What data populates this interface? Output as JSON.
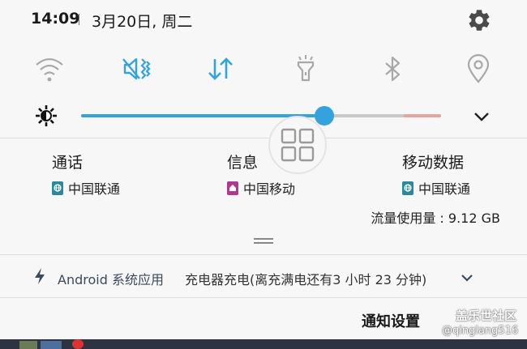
{
  "status": {
    "time": "14:09",
    "date": "3月20日, 周二"
  },
  "toggles": [
    {
      "icon": "wifi-icon",
      "active": false
    },
    {
      "icon": "vibrate-mute-icon",
      "active": true
    },
    {
      "icon": "mobile-data-icon",
      "active": true
    },
    {
      "icon": "flashlight-icon",
      "active": false
    },
    {
      "icon": "bluetooth-icon",
      "active": false
    },
    {
      "icon": "location-icon",
      "active": false
    }
  ],
  "brightness": {
    "level": 0.675,
    "auto": true
  },
  "sim": {
    "call": {
      "title": "通话",
      "carrier": "中国联通"
    },
    "message": {
      "title": "信息",
      "carrier": "中国移动"
    },
    "data": {
      "title": "移动数据",
      "carrier": "中国联通"
    }
  },
  "data_usage": "流量使用量 : 9.12 GB",
  "notification": {
    "app": "Android 系统应用",
    "text": "充电器充电(离充满电还有3 小时 23 分钟)"
  },
  "footer": {
    "settings_label": "通知设置",
    "watermark_title": "盖乐世社区",
    "watermark_user": "@qinglang516"
  },
  "colors": {
    "accent": "#34a3dd",
    "inactive_icon": "#a8a8a8",
    "sim_unicom": "#2a8a9a",
    "sim_mobile": "#b0398e"
  }
}
